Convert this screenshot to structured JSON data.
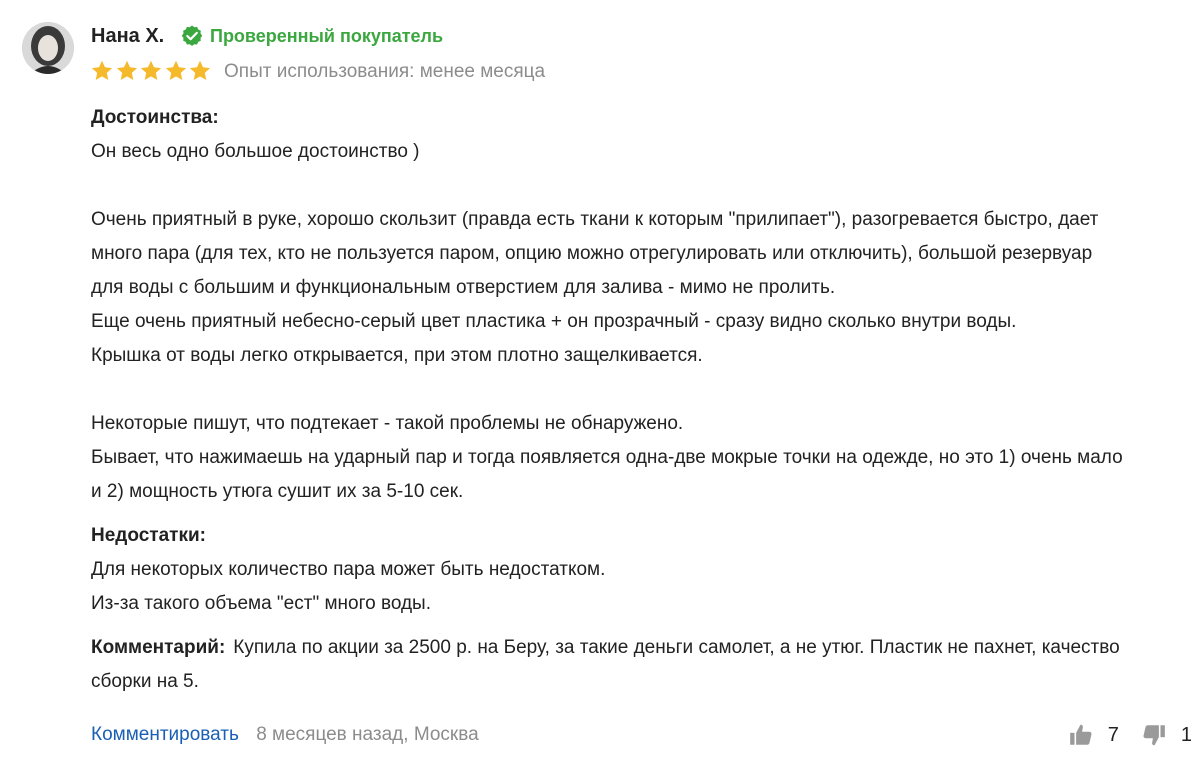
{
  "author": {
    "name": "Нана Х.",
    "verified_label": "Проверенный покупатель",
    "verified_color": "#3ba73f"
  },
  "rating": {
    "stars": 5,
    "max": 5,
    "star_color": "#f5b92c"
  },
  "usage_text": "Опыт использования: менее месяца",
  "pros": {
    "title": "Достоинства:",
    "lines": [
      "Он весь одно большое достоинство )",
      "",
      "Очень приятный в руке, хорошо скользит (правда есть ткани к которым \"прилипает\"), разогревается быстро, дает",
      "много пара (для тех, кто не пользуется паром, опцию можно отрегулировать или отключить), большой резервуар",
      "для воды с большим и функциональным отверстием для залива - мимо не пролить.",
      "Еще очень приятный небесно-серый цвет пластика + он прозрачный - сразу видно сколько внутри воды.",
      "Крышка от воды легко открывается, при этом плотно защелкивается.",
      "",
      "Некоторые пишут, что подтекает - такой проблемы не обнаружено.",
      "Бывает, что нажимаешь на ударный пар и тогда появляется одна-две мокрые точки на одежде, но это 1) очень мало",
      "и 2) мощность утюга сушит их за 5-10 сек."
    ]
  },
  "cons": {
    "title": "Недостатки:",
    "lines": [
      "Для некоторых количество пара может быть недостатком.",
      "Из-за такого объема \"ест\" много воды."
    ]
  },
  "comment": {
    "label": "Комментарий:",
    "line1": "Купила по акции за 2500 р. на Беру, за такие деньги самолет, а не утюг. Пластик не пахнет, качество",
    "line2": "сборки на 5."
  },
  "footer": {
    "comment_link": "Комментировать",
    "meta": "8 месяцев назад, Москва"
  },
  "votes": {
    "likes": "7",
    "dislikes": "1"
  },
  "icons": {
    "avatar": "user-avatar",
    "verified": "check-circle-icon",
    "star": "star-icon",
    "like": "thumbs-up-icon",
    "dislike": "thumbs-down-icon"
  }
}
